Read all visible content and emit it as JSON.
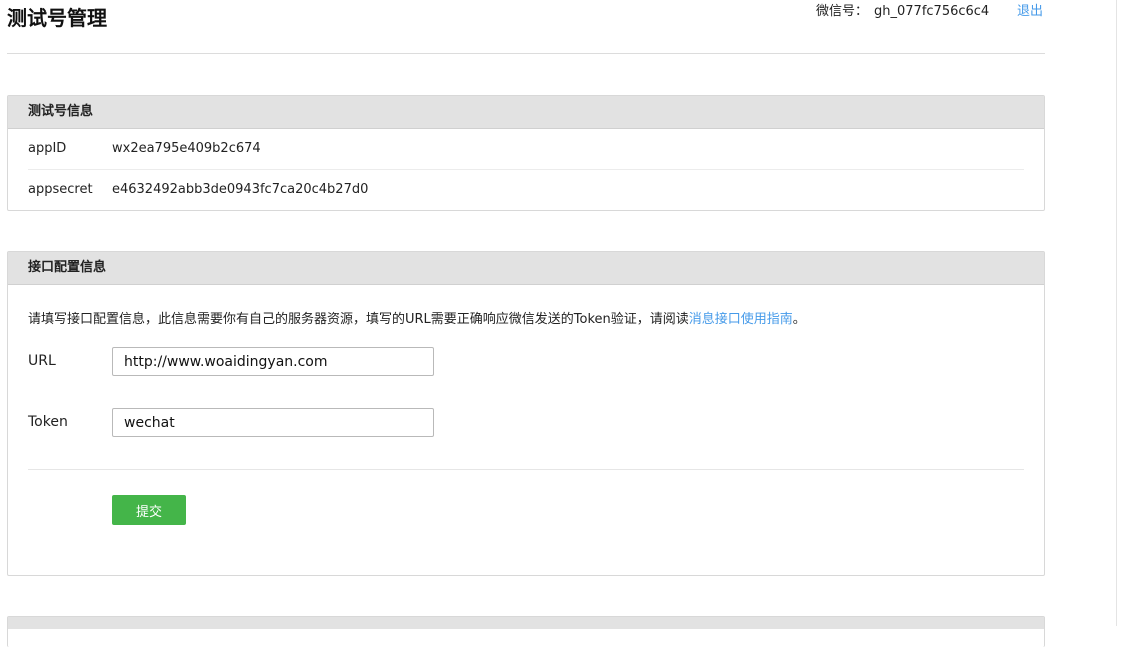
{
  "header": {
    "title": "测试号管理",
    "account_label": "微信号：",
    "account_id": "gh_077fc756c6c4",
    "logout_label": "退出"
  },
  "test_account_panel": {
    "title": "测试号信息",
    "rows": [
      {
        "key": "appID",
        "value": "wx2ea795e409b2c674"
      },
      {
        "key": "appsecret",
        "value": "e4632492abb3de0943fc7ca20c4b27d0"
      }
    ]
  },
  "interface_panel": {
    "title": "接口配置信息",
    "intro_text": "请填写接口配置信息，此信息需要你有自己的服务器资源，填写的URL需要正确响应微信发送的Token验证，请阅读",
    "intro_link": "消息接口使用指南",
    "intro_end": "。",
    "url_label": "URL",
    "url_value": "http://www.woaidingyan.com",
    "token_label": "Token",
    "token_value": "wechat",
    "submit_label": "提交",
    "submit_color": "#44b549"
  },
  "colors": {
    "link": "#459ae9",
    "panel_header_bg": "#e2e2e2"
  }
}
